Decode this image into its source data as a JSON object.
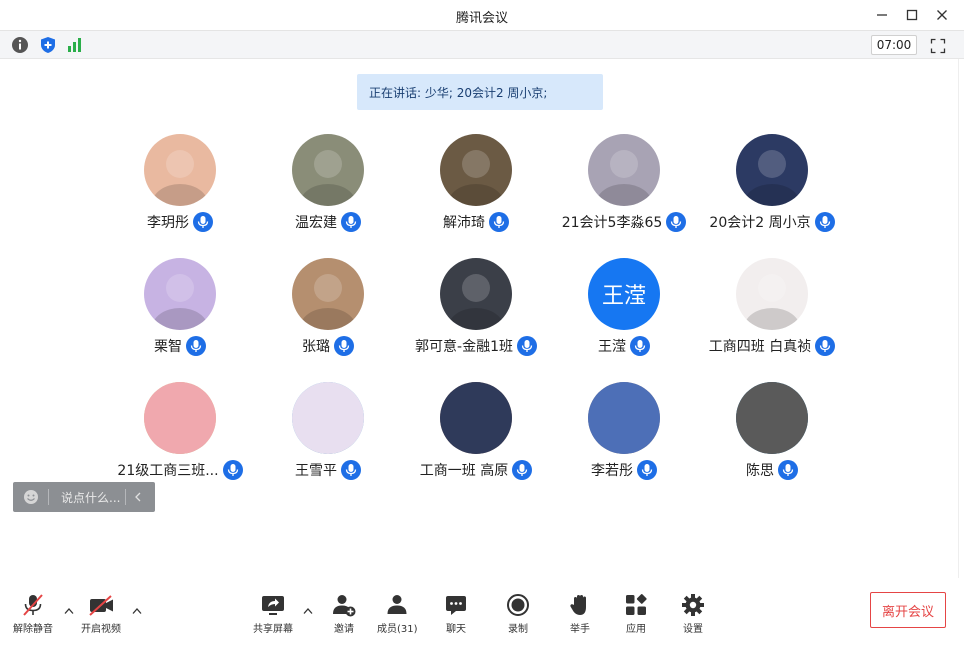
{
  "window": {
    "title": "腾讯会议"
  },
  "status": {
    "timer": "07:00"
  },
  "speaking": {
    "text": "正在讲话: 少华; 20会计2 周小京;"
  },
  "participants": [
    {
      "name": "李玥彤",
      "avatar_icon": "baby-photo-icon",
      "bg": "#e9b9a0"
    },
    {
      "name": "温宏建",
      "avatar_icon": "man-photo-icon",
      "bg": "#8a8d78"
    },
    {
      "name": "解沛琦",
      "avatar_icon": "anime-warrior-icon",
      "bg": "#6b5a44"
    },
    {
      "name": "21会计5李淼65",
      "avatar_icon": "cat-photo-icon",
      "bg": "#a8a3b4"
    },
    {
      "name": "20会计2 周小京",
      "avatar_icon": "illustration-icon",
      "bg": "#2c3a63"
    },
    {
      "name": "栗智",
      "avatar_icon": "cartoon-girl-icon",
      "bg": "#c7b3e3"
    },
    {
      "name": "张璐",
      "avatar_icon": "selfie-photo-icon",
      "bg": "#b58f6f"
    },
    {
      "name": "郭可意-金融1班",
      "avatar_icon": "crowd-photo-icon",
      "bg": "#3b3f48"
    },
    {
      "name": "王滢",
      "avatar_icon": "text-avatar-icon",
      "bg": "#1677f2",
      "initials": "王滢"
    },
    {
      "name": "工商四班 白真祯",
      "avatar_icon": "doodle-rabbit-icon",
      "bg": "#f2eeee"
    },
    {
      "name": "21级工商三班...",
      "avatar_icon": "grass-field-icon",
      "bg": "#d9d68c"
    },
    {
      "name": "王雪平",
      "avatar_icon": "doraemon-icon",
      "bg": "#5aa9d8"
    },
    {
      "name": "工商一班 高原",
      "avatar_icon": "child-photo-icon",
      "bg": "#c99b84"
    },
    {
      "name": "李若彤",
      "avatar_icon": "cat-face-icon",
      "bg": "#c8a888"
    },
    {
      "name": "陈思",
      "avatar_icon": "doraemon-underwater-icon",
      "bg": "#1f7fb8"
    }
  ],
  "chat": {
    "placeholder": "说点什么..."
  },
  "toolbar": {
    "unmute": "解除静音",
    "start_video": "开启视频",
    "share_screen": "共享屏幕",
    "invite": "邀请",
    "members": "成员(31)",
    "chat": "聊天",
    "record": "录制",
    "raise_hand": "举手",
    "apps": "应用",
    "settings": "设置",
    "leave": "离开会议"
  },
  "colors": {
    "accent": "#1e6ee6",
    "danger": "#e54545",
    "speaking_bg": "#d7e8fb"
  }
}
